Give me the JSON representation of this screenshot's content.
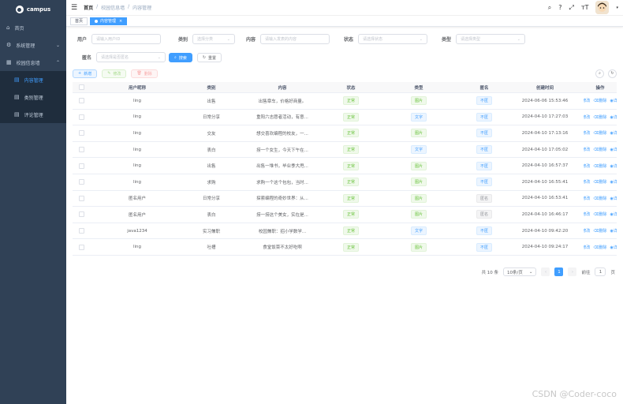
{
  "sidebar": {
    "logo_text": "campus",
    "items": [
      {
        "label": "首页",
        "icon": "home-icon"
      },
      {
        "label": "系统管理",
        "icon": "gear-icon"
      },
      {
        "label": "校园信息墙",
        "icon": "grid-icon"
      }
    ],
    "sub_items": [
      {
        "label": "内容管理",
        "icon": "list-icon",
        "active": true
      },
      {
        "label": "类别管理",
        "icon": "list-icon",
        "active": false
      },
      {
        "label": "评论管理",
        "icon": "list-icon",
        "active": false
      }
    ]
  },
  "navbar": {
    "breadcrumb": [
      "首页",
      "校园信息墙",
      "内容管理"
    ]
  },
  "tags": {
    "home": "首页",
    "current": "内容管理"
  },
  "form": {
    "user_label": "用户",
    "user_placeholder": "请输入用户ID",
    "category_label": "类别",
    "category_placeholder": "选择分类",
    "content_label": "内容",
    "content_placeholder": "请输入发表的内容",
    "status_label": "状态",
    "status_placeholder": "请选择状态",
    "type_label": "类型",
    "type_placeholder": "请选择类型",
    "anon_label": "匿名",
    "anon_placeholder": "请选择是否匿名",
    "search_btn": "搜索",
    "reset_btn": "重置"
  },
  "toolbar": {
    "add": "新增",
    "edit": "修改",
    "delete": "删除"
  },
  "table": {
    "headers": [
      "用户昵称",
      "类别",
      "内容",
      "状态",
      "类型",
      "匿名",
      "创建时间",
      "操作"
    ],
    "op_edit": "修改",
    "op_delete": "删除",
    "op_detail": "详细",
    "rows": [
      {
        "user": "ling",
        "category": "出售",
        "content": "出售章车，价格好商量。",
        "status": "正常",
        "type": "图片",
        "anon": "不匿",
        "time": "2024-06-06 15:53:46"
      },
      {
        "user": "ling",
        "category": "日常分享",
        "content": "重阳六志愿者活动，有意...",
        "status": "正常",
        "type": "文字",
        "anon": "不匿",
        "time": "2024-04-10 17:27:03"
      },
      {
        "user": "ling",
        "category": "交友",
        "content": "想交喜欢编程的校友，一...",
        "status": "正常",
        "type": "图片",
        "anon": "不匿",
        "time": "2024-04-10 17:13:16"
      },
      {
        "user": "ling",
        "category": "表白",
        "content": "捞一个女生，今天下午在...",
        "status": "正常",
        "type": "文字",
        "anon": "不匿",
        "time": "2024-04-10 17:05:02"
      },
      {
        "user": "ling",
        "category": "出售",
        "content": "出售一堆书，毕业季大甩...",
        "status": "正常",
        "type": "图片",
        "anon": "不匿",
        "time": "2024-04-10 16:57:37"
      },
      {
        "user": "ling",
        "category": "求购",
        "content": "求购一个这个包包，当时...",
        "status": "正常",
        "type": "图片",
        "anon": "不匿",
        "time": "2024-04-10 16:55:41"
      },
      {
        "user": "匿名用户",
        "category": "日常分享",
        "content": "探索编程的奇妙世界：从...",
        "status": "正常",
        "type": "图片",
        "anon": "匿名",
        "time": "2024-04-10 16:53:41"
      },
      {
        "user": "匿名用户",
        "category": "表白",
        "content": "捞一捞这个美女，实在是...",
        "status": "正常",
        "type": "图片",
        "anon": "匿名",
        "time": "2024-04-10 16:46:17"
      },
      {
        "user": "java1234",
        "category": "实习兼职",
        "content": "校园兼职：招小学数学...",
        "status": "正常",
        "type": "文字",
        "anon": "不匿",
        "time": "2024-04-10 09:42:20"
      },
      {
        "user": "ling",
        "category": "吐槽",
        "content": "食堂饭菜不太好吃啊",
        "status": "正常",
        "type": "图片",
        "anon": "不匿",
        "time": "2024-04-10 09:24:17"
      }
    ]
  },
  "pager": {
    "total": "共 10 条",
    "size": "10条/页",
    "current": "1",
    "goto_label": "前往",
    "goto_value": "1",
    "page_suffix": "页"
  },
  "watermark": "CSDN @Coder-coco"
}
